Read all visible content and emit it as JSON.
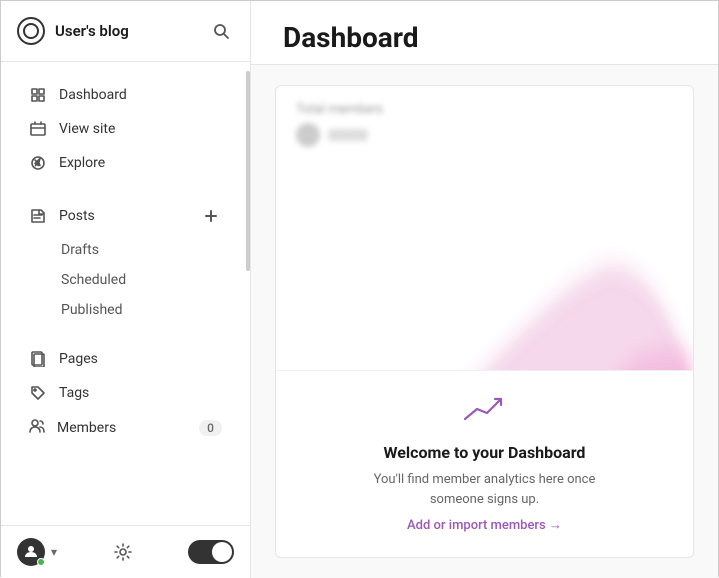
{
  "sidebar": {
    "brand_name": "User's blog",
    "nav_items": [
      {
        "id": "dashboard",
        "label": "Dashboard",
        "icon": "dashboard-icon"
      },
      {
        "id": "view-site",
        "label": "View site",
        "icon": "view-site-icon"
      },
      {
        "id": "explore",
        "label": "Explore",
        "icon": "explore-icon"
      }
    ],
    "posts_label": "Posts",
    "sub_items": [
      {
        "id": "drafts",
        "label": "Drafts"
      },
      {
        "id": "scheduled",
        "label": "Scheduled"
      },
      {
        "id": "published",
        "label": "Published"
      }
    ],
    "pages_label": "Pages",
    "tags_label": "Tags",
    "members_label": "Members",
    "members_badge": "0"
  },
  "main": {
    "title": "Dashboard",
    "card": {
      "label": "Total members",
      "value_placeholder": "0..."
    },
    "welcome": {
      "title": "Welcome to your Dashboard",
      "description": "You'll find member analytics here once someone signs up.",
      "cta": "Add or import members →"
    }
  }
}
